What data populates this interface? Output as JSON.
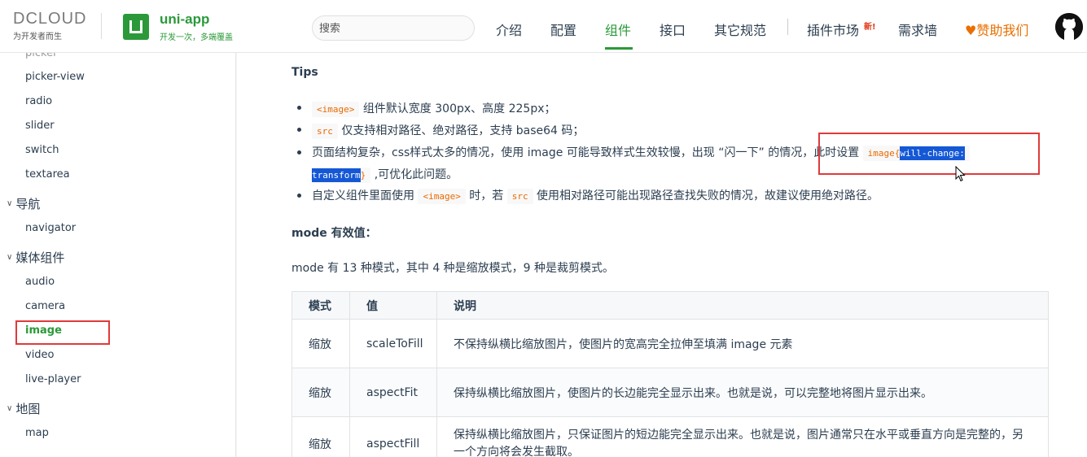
{
  "header": {
    "dcloud_logo": "DCLOUD",
    "dcloud_tagline": "为开发者而生",
    "uniapp_title": "uni-app",
    "uniapp_subtitle": "开发一次，多端覆盖",
    "search_placeholder": "搜索",
    "nav": [
      {
        "label": "介绍"
      },
      {
        "label": "配置"
      },
      {
        "label": "组件"
      },
      {
        "label": "接口"
      },
      {
        "label": "其它规范"
      },
      {
        "label": "插件市场"
      },
      {
        "label": "需求墙"
      }
    ],
    "new_badge": "新!",
    "sponsor_label": "赞助我们",
    "colors": {
      "brand": "#2b9939",
      "sponsor": "#e86f00"
    }
  },
  "sidebar": {
    "items_top": [
      "picker",
      "picker-view",
      "radio",
      "slider",
      "switch",
      "textarea"
    ],
    "group_nav": "导航",
    "nav_items": [
      "navigator"
    ],
    "group_media": "媒体组件",
    "media_items": [
      "audio",
      "camera",
      "image",
      "video",
      "live-player"
    ],
    "group_map": "地图",
    "map_items": [
      "map"
    ]
  },
  "content": {
    "tips_heading": "Tips",
    "tip1_code": "<image>",
    "tip1_text": "组件默认宽度 300px、高度 225px；",
    "tip2_code": "src",
    "tip2_text": "仅支持相对路径、绝对路径，支持 base64 码；",
    "tip3_text": "页面结构复杂，css样式太多的情况，使用 image 可能导致样式生效较慢，出现 “闪一下” 的情况，此时设置",
    "tip3_code_a": "image{",
    "tip3_code_sel1": "will-change:",
    "tip3_code_sel2": "transform",
    "tip3_code_b": "}",
    "tip3_text_after": ",可优化此问题。",
    "tip4_text_a": "自定义组件里面使用",
    "tip4_code_a": "<image>",
    "tip4_text_b": "时，若",
    "tip4_code_b": "src",
    "tip4_text_c": "使用相对路径可能出现路径查找失败的情况，故建议使用绝对路径。",
    "mode_heading_code": "mode",
    "mode_heading_text": "有效值：",
    "mode_desc": "mode 有 13 种模式，其中 4 种是缩放模式，9 种是裁剪模式。"
  },
  "table": {
    "headers": [
      "模式",
      "值",
      "说明"
    ],
    "rows": [
      {
        "mode": "缩放",
        "value": "scaleToFill",
        "desc": "不保持纵横比缩放图片，使图片的宽高完全拉伸至填满 image 元素"
      },
      {
        "mode": "缩放",
        "value": "aspectFit",
        "desc": "保持纵横比缩放图片，使图片的长边能完全显示出来。也就是说，可以完整地将图片显示出来。"
      },
      {
        "mode": "缩放",
        "value": "aspectFill",
        "desc": "保持纵横比缩放图片，只保证图片的短边能完全显示出来。也就是说，图片通常只在水平或垂直方向是完整的，另一个方向将会发生截取。"
      }
    ]
  }
}
